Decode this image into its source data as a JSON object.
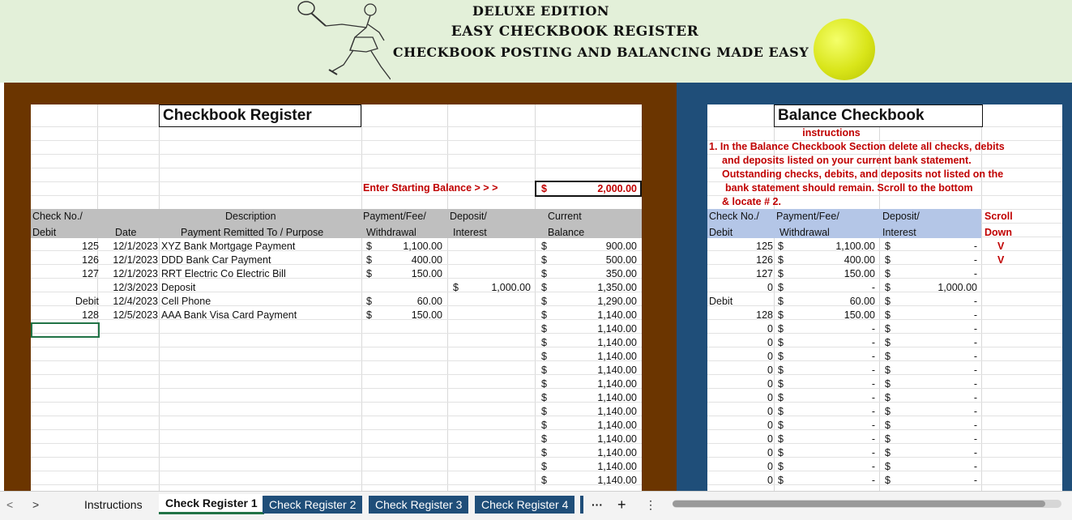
{
  "banner": {
    "line1": "DELUXE EDITION",
    "line2": "EASY CHECKBOOK REGISTER",
    "line3": "CHECKBOOK POSTING AND BALANCING MADE EASY"
  },
  "register": {
    "title": "Checkbook Register",
    "start_label": "Enter Starting Balance > > >",
    "start_dollar": "$",
    "start_value": "2,000.00",
    "headers": {
      "checkno": "Check No./",
      "checkno2": "Debit",
      "date": "Date",
      "desc": "Description",
      "desc2": "Payment Remitted To / Purpose",
      "pay": "Payment/Fee/",
      "pay2": "Withdrawal",
      "dep": "Deposit/",
      "dep2": "Interest",
      "bal": "Current",
      "bal2": "Balance"
    },
    "rows": [
      {
        "no": "125",
        "date": "12/1/2023",
        "desc": "XYZ Bank Mortgage Payment",
        "pd": "$",
        "pay": "1,100.00",
        "dd": "",
        "dep": "",
        "bd": "$",
        "bal": "900.00"
      },
      {
        "no": "126",
        "date": "12/1/2023",
        "desc": "DDD Bank Car Payment",
        "pd": "$",
        "pay": "400.00",
        "dd": "",
        "dep": "",
        "bd": "$",
        "bal": "500.00"
      },
      {
        "no": "127",
        "date": "12/1/2023",
        "desc": "RRT Electric Co Electric Bill",
        "pd": "$",
        "pay": "150.00",
        "dd": "",
        "dep": "",
        "bd": "$",
        "bal": "350.00"
      },
      {
        "no": "",
        "date": "12/3/2023",
        "desc": "Deposit",
        "pd": "",
        "pay": "",
        "dd": "$",
        "dep": "1,000.00",
        "bd": "$",
        "bal": "1,350.00"
      },
      {
        "no": "Debit",
        "date": "12/4/2023",
        "desc": "Cell Phone",
        "pd": "$",
        "pay": "60.00",
        "dd": "",
        "dep": "",
        "bd": "$",
        "bal": "1,290.00"
      },
      {
        "no": "128",
        "date": "12/5/2023",
        "desc": "AAA Bank Visa Card Payment",
        "pd": "$",
        "pay": "150.00",
        "dd": "",
        "dep": "",
        "bd": "$",
        "bal": "1,140.00"
      },
      {
        "no": "",
        "date": "",
        "desc": "",
        "pd": "",
        "pay": "",
        "dd": "",
        "dep": "",
        "bd": "$",
        "bal": "1,140.00"
      },
      {
        "no": "",
        "date": "",
        "desc": "",
        "pd": "",
        "pay": "",
        "dd": "",
        "dep": "",
        "bd": "$",
        "bal": "1,140.00"
      },
      {
        "no": "",
        "date": "",
        "desc": "",
        "pd": "",
        "pay": "",
        "dd": "",
        "dep": "",
        "bd": "$",
        "bal": "1,140.00"
      },
      {
        "no": "",
        "date": "",
        "desc": "",
        "pd": "",
        "pay": "",
        "dd": "",
        "dep": "",
        "bd": "$",
        "bal": "1,140.00"
      },
      {
        "no": "",
        "date": "",
        "desc": "",
        "pd": "",
        "pay": "",
        "dd": "",
        "dep": "",
        "bd": "$",
        "bal": "1,140.00"
      },
      {
        "no": "",
        "date": "",
        "desc": "",
        "pd": "",
        "pay": "",
        "dd": "",
        "dep": "",
        "bd": "$",
        "bal": "1,140.00"
      },
      {
        "no": "",
        "date": "",
        "desc": "",
        "pd": "",
        "pay": "",
        "dd": "",
        "dep": "",
        "bd": "$",
        "bal": "1,140.00"
      },
      {
        "no": "",
        "date": "",
        "desc": "",
        "pd": "",
        "pay": "",
        "dd": "",
        "dep": "",
        "bd": "$",
        "bal": "1,140.00"
      },
      {
        "no": "",
        "date": "",
        "desc": "",
        "pd": "",
        "pay": "",
        "dd": "",
        "dep": "",
        "bd": "$",
        "bal": "1,140.00"
      },
      {
        "no": "",
        "date": "",
        "desc": "",
        "pd": "",
        "pay": "",
        "dd": "",
        "dep": "",
        "bd": "$",
        "bal": "1,140.00"
      },
      {
        "no": "",
        "date": "",
        "desc": "",
        "pd": "",
        "pay": "",
        "dd": "",
        "dep": "",
        "bd": "$",
        "bal": "1,140.00"
      },
      {
        "no": "",
        "date": "",
        "desc": "",
        "pd": "",
        "pay": "",
        "dd": "",
        "dep": "",
        "bd": "$",
        "bal": "1,140.00"
      }
    ]
  },
  "balance": {
    "title": "Balance Checkbook",
    "instr_title": "instructions",
    "instr_lines": [
      "1. In the Balance Checkbook Section delete all checks, debits",
      "and deposits listed on your current bank statement.",
      "Outstanding checks, debits, and deposits not listed on the",
      "bank statement should remain. Scroll to the bottom",
      "& locate # 2."
    ],
    "headers": {
      "checkno": "Check No./",
      "checkno2": "Debit",
      "pay": "Payment/Fee/",
      "pay2": "Withdrawal",
      "dep": "Deposit/",
      "dep2": "Interest",
      "scroll": "Scroll",
      "scroll2": "Down"
    },
    "arrows": [
      "V",
      "V"
    ],
    "rows": [
      {
        "no": "125",
        "pd": "$",
        "pay": "1,100.00",
        "dd": "$",
        "dep": "-"
      },
      {
        "no": "126",
        "pd": "$",
        "pay": "400.00",
        "dd": "$",
        "dep": "-"
      },
      {
        "no": "127",
        "pd": "$",
        "pay": "150.00",
        "dd": "$",
        "dep": "-"
      },
      {
        "no": "0",
        "pd": "$",
        "pay": "-",
        "dd": "$",
        "dep": "1,000.00"
      },
      {
        "no": "Debit",
        "pd": "$",
        "pay": "60.00",
        "dd": "$",
        "dep": "-"
      },
      {
        "no": "128",
        "pd": "$",
        "pay": "150.00",
        "dd": "$",
        "dep": "-"
      },
      {
        "no": "0",
        "pd": "$",
        "pay": "-",
        "dd": "$",
        "dep": "-"
      },
      {
        "no": "0",
        "pd": "$",
        "pay": "-",
        "dd": "$",
        "dep": "-"
      },
      {
        "no": "0",
        "pd": "$",
        "pay": "-",
        "dd": "$",
        "dep": "-"
      },
      {
        "no": "0",
        "pd": "$",
        "pay": "-",
        "dd": "$",
        "dep": "-"
      },
      {
        "no": "0",
        "pd": "$",
        "pay": "-",
        "dd": "$",
        "dep": "-"
      },
      {
        "no": "0",
        "pd": "$",
        "pay": "-",
        "dd": "$",
        "dep": "-"
      },
      {
        "no": "0",
        "pd": "$",
        "pay": "-",
        "dd": "$",
        "dep": "-"
      },
      {
        "no": "0",
        "pd": "$",
        "pay": "-",
        "dd": "$",
        "dep": "-"
      },
      {
        "no": "0",
        "pd": "$",
        "pay": "-",
        "dd": "$",
        "dep": "-"
      },
      {
        "no": "0",
        "pd": "$",
        "pay": "-",
        "dd": "$",
        "dep": "-"
      },
      {
        "no": "0",
        "pd": "$",
        "pay": "-",
        "dd": "$",
        "dep": "-"
      },
      {
        "no": "0",
        "pd": "$",
        "pay": "-",
        "dd": "$",
        "dep": "-"
      }
    ]
  },
  "tabs": {
    "prev": "<",
    "next": ">",
    "items": [
      "Instructions",
      "Check Register 1",
      "Check Register 2",
      "Check Register 3",
      "Check Register 4"
    ],
    "more": "···",
    "add": "+",
    "menu": "⋮"
  },
  "colors": {
    "banner_bg": "#e3f0d9",
    "left_frame": "#6b3500",
    "right_frame": "#1f4e79",
    "header_gray": "#bfbfbf",
    "header_blue": "#b4c6e7",
    "accent_red": "#c00000",
    "excel_green": "#217346"
  }
}
